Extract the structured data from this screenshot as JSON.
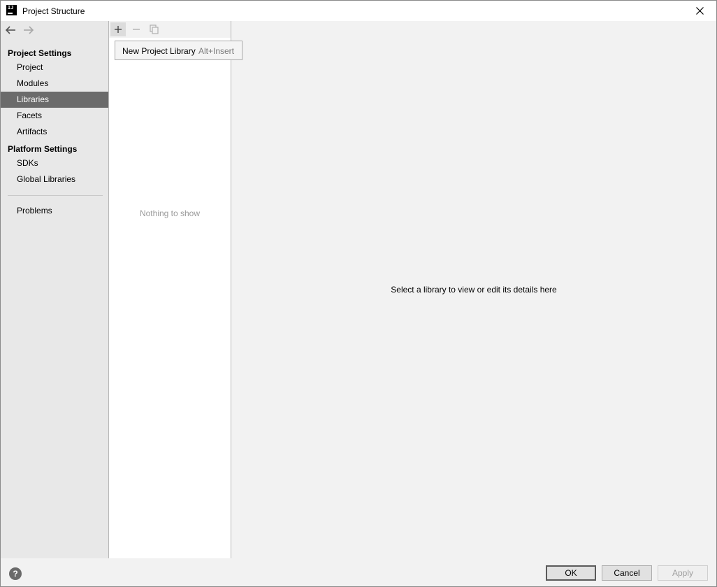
{
  "window": {
    "title": "Project Structure",
    "logo_text": "IJ"
  },
  "sidebar": {
    "sections": [
      {
        "header": "Project Settings",
        "items": [
          {
            "label": "Project",
            "selected": false
          },
          {
            "label": "Modules",
            "selected": false
          },
          {
            "label": "Libraries",
            "selected": true
          },
          {
            "label": "Facets",
            "selected": false
          },
          {
            "label": "Artifacts",
            "selected": false
          }
        ]
      },
      {
        "header": "Platform Settings",
        "items": [
          {
            "label": "SDKs",
            "selected": false
          },
          {
            "label": "Global Libraries",
            "selected": false
          }
        ]
      }
    ],
    "problems_label": "Problems"
  },
  "middle": {
    "empty_text": "Nothing to show",
    "popup": {
      "label": "New Project Library",
      "shortcut": "Alt+Insert"
    }
  },
  "content": {
    "message": "Select a library to view or edit its details here"
  },
  "footer": {
    "help_label": "?",
    "ok_label": "OK",
    "cancel_label": "Cancel",
    "apply_label": "Apply",
    "apply_enabled": false
  },
  "colors": {
    "selected_bg": "#6b6b6b",
    "sidebar_bg": "#e8e8e8",
    "panel_bg": "#f2f2f2",
    "disabled_text": "#9e9e9e"
  }
}
